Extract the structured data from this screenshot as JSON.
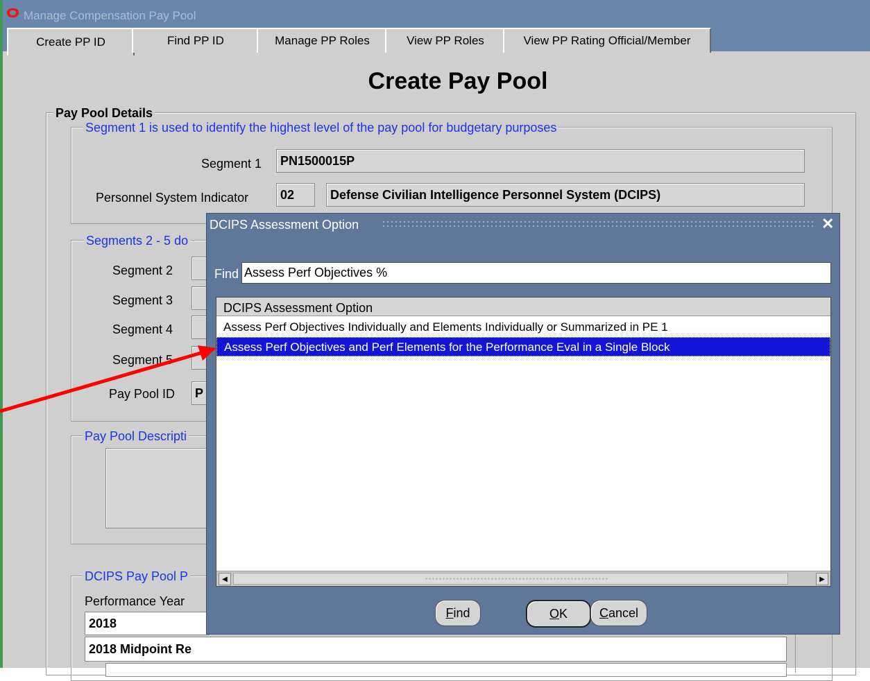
{
  "window": {
    "title": "Manage Compensation Pay Pool"
  },
  "tabs": [
    {
      "label": "Create PP ID",
      "active": true
    },
    {
      "label": "Find PP ID",
      "active": false
    },
    {
      "label": "Manage PP Roles",
      "active": false
    },
    {
      "label": "View PP Roles",
      "active": false
    },
    {
      "label": "View PP Rating Official/Member",
      "active": false
    }
  ],
  "page": {
    "title": "Create Pay Pool",
    "section_title": "Pay Pool Details",
    "segment1_legend": "Segment 1 is used to identify the highest level of the pay pool for budgetary purposes",
    "segment1_label": "Segment 1",
    "segment1_value": "PN1500015P",
    "psi_label": "Personnel System Indicator",
    "psi_code": "02",
    "psi_name": "Defense Civilian Intelligence Personnel System (DCIPS)",
    "segments_legend": "Segments 2 - 5 do",
    "segment2_label": "Segment 2",
    "segment3_label": "Segment 3",
    "segment4_label": "Segment 4",
    "segment5_label": "Segment 5",
    "pay_pool_id_label": "Pay Pool ID",
    "pay_pool_id_value": "P",
    "description_legend": "Pay Pool Descripti",
    "dcips_legend": "DCIPS Pay Pool P",
    "performance_year_label": "Performance Year",
    "performance_year_value": "2018",
    "midpoint_value": "2018 Midpoint Re"
  },
  "dialog": {
    "title": "DCIPS Assessment Option",
    "find_label": "Find",
    "find_value": "Assess Perf Objectives %",
    "list_header": "DCIPS Assessment Option",
    "rows": [
      {
        "text": "Assess Perf Objectives Individually and Elements Individually or Summarized in PE 1",
        "selected": false
      },
      {
        "text": "Assess Perf Objectives and Perf Elements for the Performance Eval in a Single Block",
        "selected": true
      }
    ],
    "buttons": {
      "find_mnemonic": "F",
      "find_rest": "ind",
      "ok_mnemonic": "O",
      "ok_rest": "K",
      "cancel_mnemonic": "C",
      "cancel_rest": "ancel"
    }
  },
  "colors": {
    "titlebar": "#6a86ac",
    "dialog": "#5f7799",
    "selection": "#1414d8",
    "legend_text": "#1a34e8",
    "annotation_arrow": "#ff0000"
  }
}
